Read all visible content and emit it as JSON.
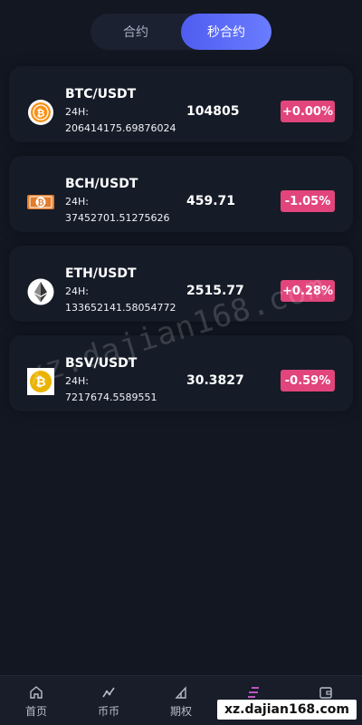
{
  "tabs": [
    {
      "label": "合约",
      "active": false
    },
    {
      "label": "秒合约",
      "active": true
    }
  ],
  "colors": {
    "background": "#121722",
    "card": "#151b27",
    "accent": "#5b6cff",
    "change_badge": "#e1457b"
  },
  "markets": [
    {
      "icon": "btc-icon",
      "pair": "BTC/USDT",
      "volume_label": "24H:",
      "volume": "206414175.69876024",
      "price": "104805",
      "change": "+0.00%"
    },
    {
      "icon": "bch-icon",
      "pair": "BCH/USDT",
      "volume_label": "24H:",
      "volume": "37452701.51275626",
      "price": "459.71",
      "change": "-1.05%"
    },
    {
      "icon": "eth-icon",
      "pair": "ETH/USDT",
      "volume_label": "24H:",
      "volume": "133652141.58054772",
      "price": "2515.77",
      "change": "+0.28%"
    },
    {
      "icon": "bsv-icon",
      "pair": "BSV/USDT",
      "volume_label": "24H:",
      "volume": "7217674.5589551",
      "price": "30.3827",
      "change": "-0.59%"
    }
  ],
  "watermark": "xz.dajian168.com",
  "bottom_nav": [
    {
      "label": "首页",
      "icon": "home-icon"
    },
    {
      "label": "币币",
      "icon": "chart-icon"
    },
    {
      "label": "期权",
      "icon": "options-icon"
    },
    {
      "label": "",
      "icon": "contract-icon",
      "active": true
    },
    {
      "label": "",
      "icon": "wallet-icon"
    }
  ],
  "footer_domain": "xz.dajian168.com"
}
